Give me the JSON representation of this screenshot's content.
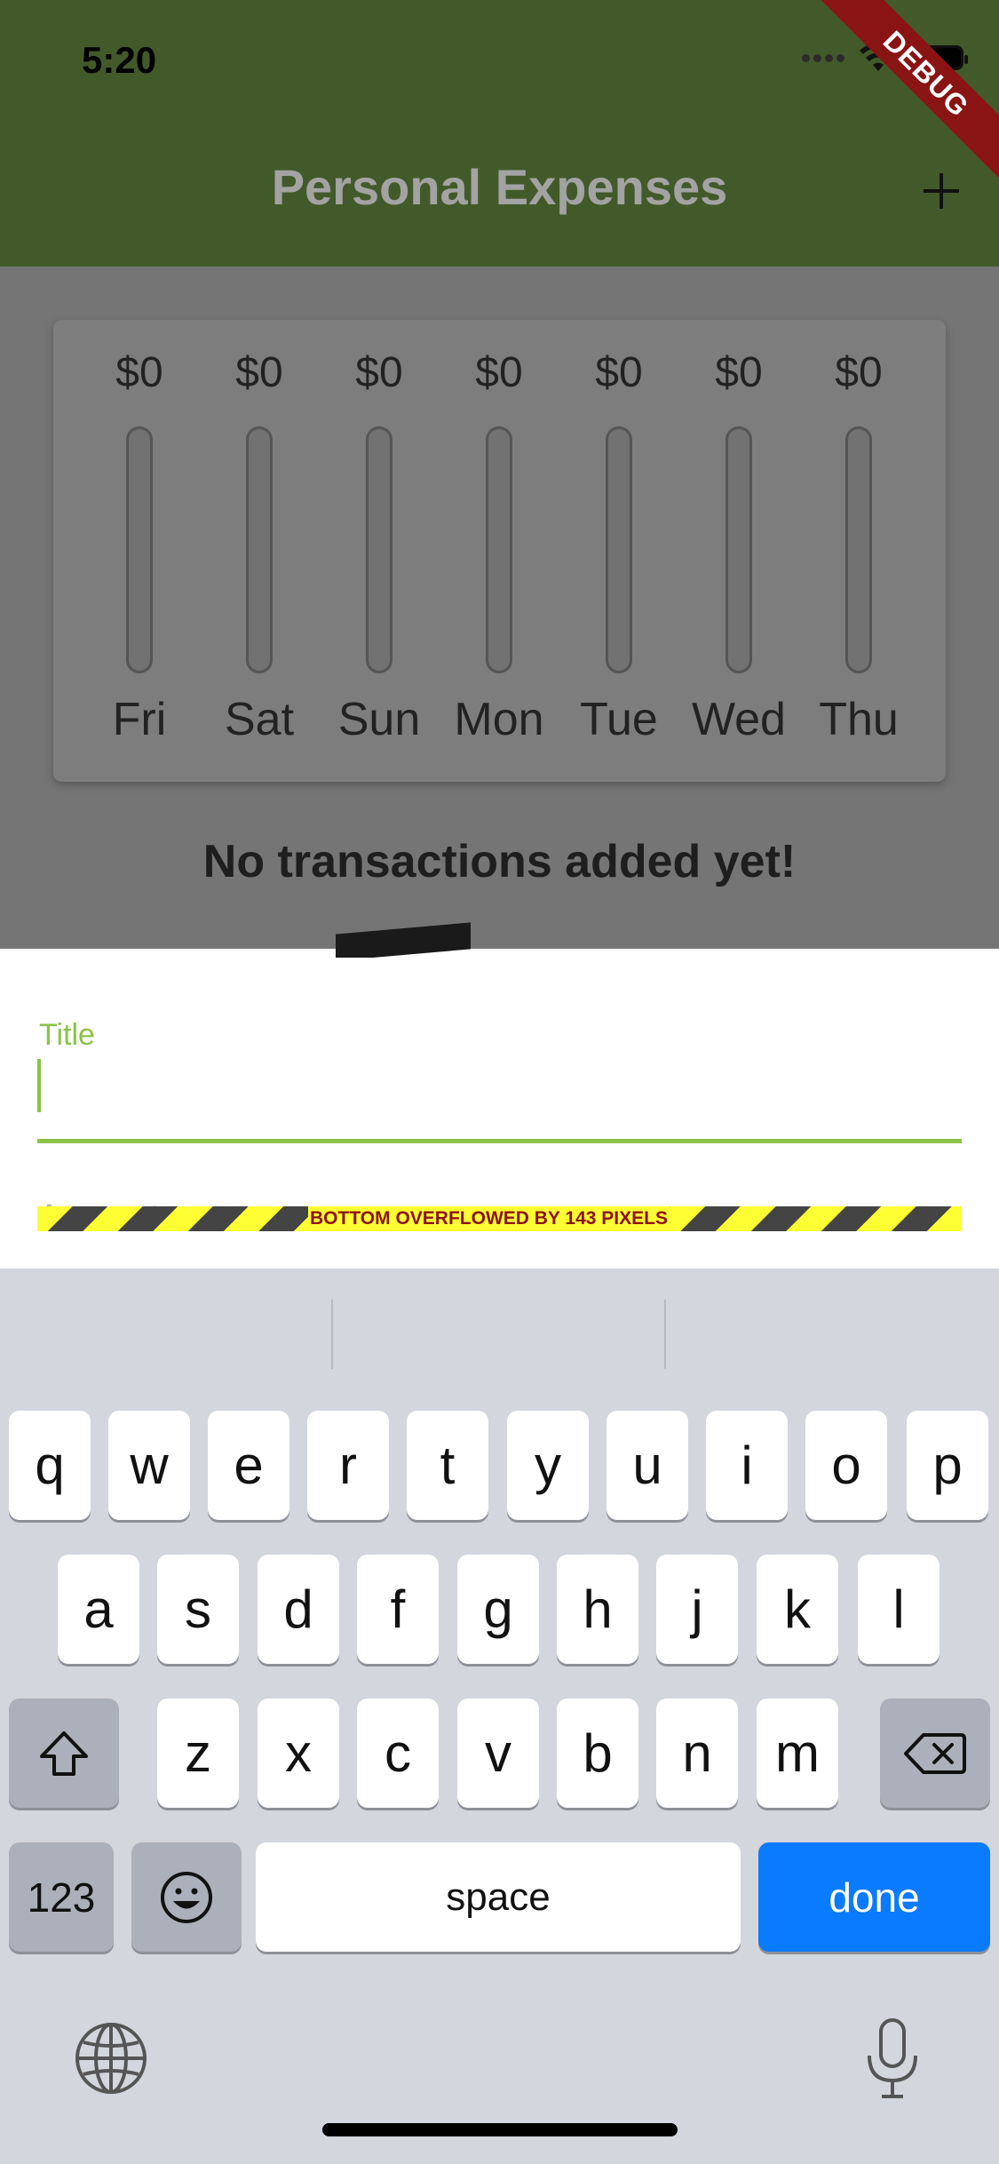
{
  "status_bar": {
    "time": "5:20"
  },
  "app_bar": {
    "title": "Personal Expenses",
    "add_label": "+"
  },
  "debug_banner": "DEBUG",
  "chart": {
    "days": [
      {
        "amount": "$0",
        "day": "Fri",
        "fill": 0
      },
      {
        "amount": "$0",
        "day": "Sat",
        "fill": 0
      },
      {
        "amount": "$0",
        "day": "Sun",
        "fill": 0
      },
      {
        "amount": "$0",
        "day": "Mon",
        "fill": 0
      },
      {
        "amount": "$0",
        "day": "Tue",
        "fill": 0
      },
      {
        "amount": "$0",
        "day": "Wed",
        "fill": 0
      },
      {
        "amount": "$0",
        "day": "Thu",
        "fill": 0
      }
    ]
  },
  "empty_state": {
    "message": "No transactions added yet!"
  },
  "sheet": {
    "title_label": "Title",
    "title_value": "",
    "amount_label": "Amount",
    "overflow_message": "BOTTOM OVERFLOWED BY 143 PIXELS"
  },
  "keyboard": {
    "row1": [
      "q",
      "w",
      "e",
      "r",
      "t",
      "y",
      "u",
      "i",
      "o",
      "p"
    ],
    "row2": [
      "a",
      "s",
      "d",
      "f",
      "g",
      "h",
      "j",
      "k",
      "l"
    ],
    "row3": [
      "z",
      "x",
      "c",
      "v",
      "b",
      "n",
      "m"
    ],
    "numbers_label": "123",
    "space_label": "space",
    "done_label": "done"
  },
  "colors": {
    "appbar": "#425a29",
    "accent": "#8bc34a",
    "done": "#0a7aff",
    "debug": "#8a1414"
  }
}
